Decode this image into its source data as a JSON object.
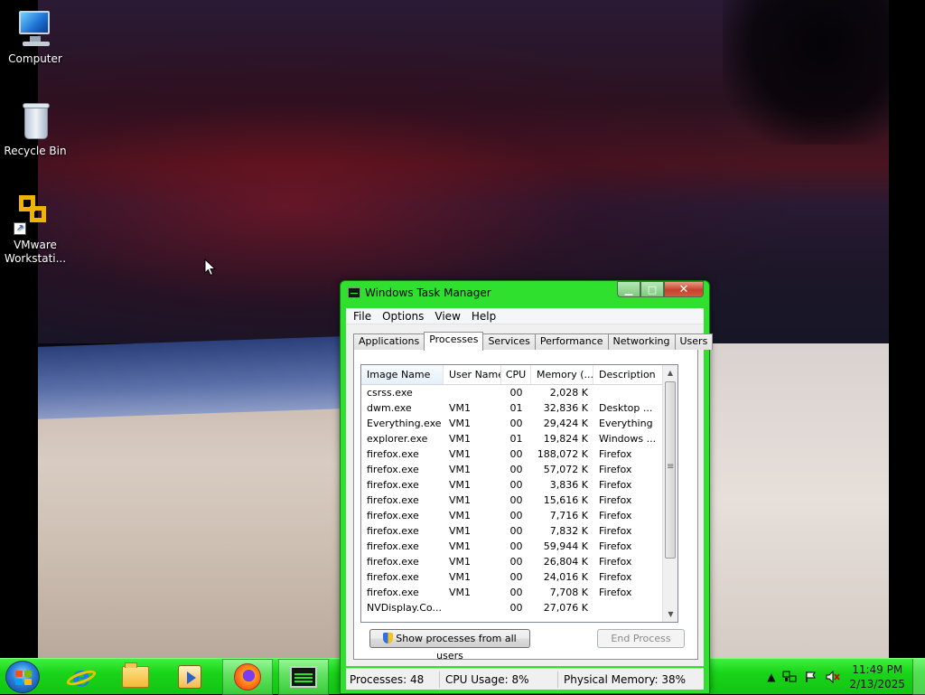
{
  "desktop": {
    "icons": [
      {
        "label": "Computer"
      },
      {
        "label": "Recycle Bin"
      },
      {
        "label": "VMware Workstati..."
      }
    ]
  },
  "window": {
    "title": "Windows Task Manager",
    "controls": {
      "minimize": "▁",
      "maximize": "□",
      "close": "✕"
    },
    "menu": [
      "File",
      "Options",
      "View",
      "Help"
    ],
    "tabs": [
      "Applications",
      "Processes",
      "Services",
      "Performance",
      "Networking",
      "Users"
    ],
    "active_tab": "Processes",
    "columns": [
      "Image Name",
      "User Name",
      "CPU",
      "Memory (...",
      "Description"
    ],
    "processes": [
      {
        "name": "csrss.exe",
        "user": "",
        "cpu": "00",
        "mem": "2,028 K",
        "desc": ""
      },
      {
        "name": "dwm.exe",
        "user": "VM1",
        "cpu": "01",
        "mem": "32,836 K",
        "desc": "Desktop ..."
      },
      {
        "name": "Everything.exe",
        "user": "VM1",
        "cpu": "00",
        "mem": "29,424 K",
        "desc": "Everything"
      },
      {
        "name": "explorer.exe",
        "user": "VM1",
        "cpu": "01",
        "mem": "19,824 K",
        "desc": "Windows ..."
      },
      {
        "name": "firefox.exe",
        "user": "VM1",
        "cpu": "00",
        "mem": "188,072 K",
        "desc": "Firefox"
      },
      {
        "name": "firefox.exe",
        "user": "VM1",
        "cpu": "00",
        "mem": "57,072 K",
        "desc": "Firefox"
      },
      {
        "name": "firefox.exe",
        "user": "VM1",
        "cpu": "00",
        "mem": "3,836 K",
        "desc": "Firefox"
      },
      {
        "name": "firefox.exe",
        "user": "VM1",
        "cpu": "00",
        "mem": "15,616 K",
        "desc": "Firefox"
      },
      {
        "name": "firefox.exe",
        "user": "VM1",
        "cpu": "00",
        "mem": "7,716 K",
        "desc": "Firefox"
      },
      {
        "name": "firefox.exe",
        "user": "VM1",
        "cpu": "00",
        "mem": "7,832 K",
        "desc": "Firefox"
      },
      {
        "name": "firefox.exe",
        "user": "VM1",
        "cpu": "00",
        "mem": "59,944 K",
        "desc": "Firefox"
      },
      {
        "name": "firefox.exe",
        "user": "VM1",
        "cpu": "00",
        "mem": "26,804 K",
        "desc": "Firefox"
      },
      {
        "name": "firefox.exe",
        "user": "VM1",
        "cpu": "00",
        "mem": "24,016 K",
        "desc": "Firefox"
      },
      {
        "name": "firefox.exe",
        "user": "VM1",
        "cpu": "00",
        "mem": "7,708 K",
        "desc": "Firefox"
      },
      {
        "name": "NVDisplay.Co...",
        "user": "",
        "cpu": "00",
        "mem": "27,076 K",
        "desc": ""
      }
    ],
    "show_all_label": "Show processes from all users",
    "end_process_label": "End Process",
    "status": {
      "processes": "Processes: 48",
      "cpu": "CPU Usage: 8%",
      "memory": "Physical Memory: 38%"
    }
  },
  "taskbar": {
    "pinned": [
      "start-icon",
      "internet-explorer-icon",
      "file-explorer-icon",
      "media-player-icon",
      "firefox-icon",
      "task-manager-icon"
    ],
    "tray": {
      "chevron": "▲",
      "time": "11:49 PM",
      "date": "2/13/2025"
    },
    "accent": "#1fd41f"
  }
}
